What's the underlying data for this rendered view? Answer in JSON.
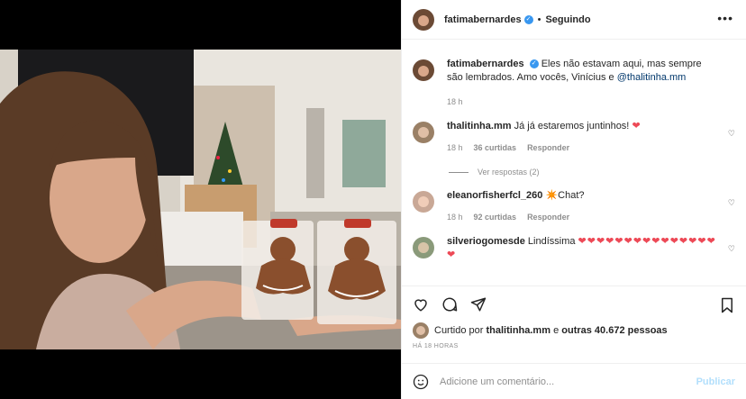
{
  "header": {
    "username": "fatimabernardes",
    "separator": "•",
    "follow_status": "Seguindo",
    "more_icon": "more-horizontal-icon"
  },
  "caption": {
    "username": "fatimabernardes",
    "text": "Eles não estavam aqui, mas sempre são lembrados. Amo vocês, Vinícius e ",
    "mention": "@thalitinha.mm",
    "time": "18 h"
  },
  "comments": [
    {
      "username": "thalitinha.mm",
      "text": "Já já estaremos juntinhos! ",
      "emoji": "❤",
      "time": "18 h",
      "likes": "36 curtidas",
      "reply": "Responder",
      "view_replies": "Ver respostas (2)"
    },
    {
      "username": "eleanorfisherfcl_260",
      "text": "✴️Chat?",
      "time": "18 h",
      "likes": "92 curtidas",
      "reply": "Responder"
    },
    {
      "username": "silveriogomesde",
      "text": "Lindíssima ",
      "emoji": "❤❤❤❤❤❤❤❤❤❤❤❤❤❤❤❤"
    }
  ],
  "actions": {
    "like_icon": "heart-outline-icon",
    "comment_icon": "comment-icon",
    "share_icon": "send-icon",
    "save_icon": "bookmark-icon"
  },
  "likes_line": {
    "prefix": "Curtido por ",
    "user": "thalitinha.mm",
    "middle": " e ",
    "others": "outras 40.672 pessoas"
  },
  "timestamp": "HÁ 18 HORAS",
  "add_comment": {
    "placeholder": "Adicione um comentário...",
    "publish": "Publicar"
  },
  "colors": {
    "accent": "#3897f0",
    "heart": "#ed4956",
    "publish_disabled": "#b2dffc",
    "muted": "#8e8e8e"
  }
}
